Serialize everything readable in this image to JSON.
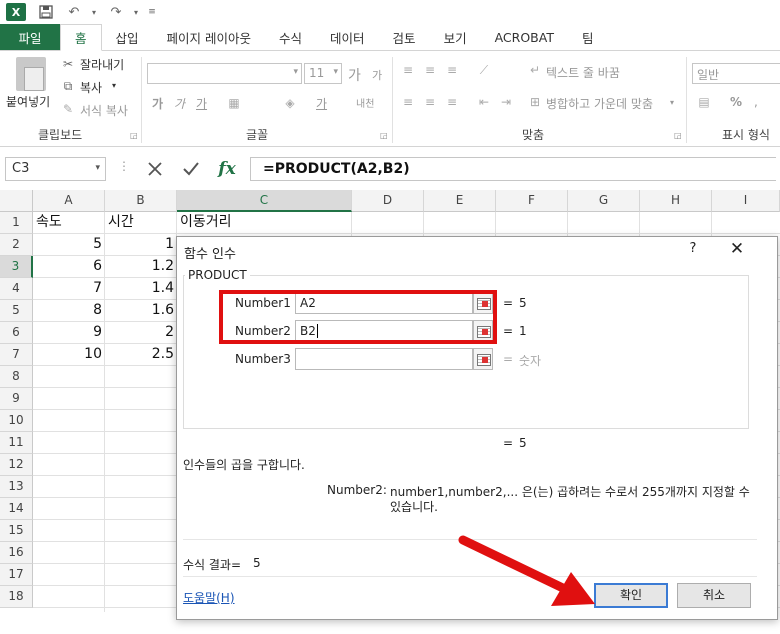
{
  "quick_access": {
    "logo": "X",
    "icons": [
      "save-icon",
      "undo-icon",
      "redo-icon",
      "customize-icon"
    ]
  },
  "tabs": [
    "파일",
    "홈",
    "삽입",
    "페이지 레이아웃",
    "수식",
    "데이터",
    "검토",
    "보기",
    "ACROBAT",
    "팀"
  ],
  "ribbon": {
    "clipboard": {
      "paste": "붙여넣기",
      "cut": "잘라내기",
      "copy": "복사",
      "format_painter": "서식 복사",
      "label": "클립보드"
    },
    "font": {
      "size": "11",
      "grow": "가",
      "shrink": "가",
      "bold": "가",
      "italic": "가",
      "underline": "가",
      "color": "가",
      "phonetic": "내천",
      "label": "글꼴"
    },
    "alignment": {
      "wrap": "텍스트 줄 바꿈",
      "merge": "병합하고 가운데 맞춤",
      "label": "맞춤"
    },
    "number": {
      "format": "일반",
      "percent": "%",
      "label": "표시 형식"
    }
  },
  "formula_bar": {
    "name_box": "C3",
    "fx": "fx",
    "formula": "=PRODUCT(A2,B2)"
  },
  "grid": {
    "columns": [
      "A",
      "B",
      "C",
      "D",
      "E",
      "F",
      "G",
      "H",
      "I"
    ],
    "rows": [
      "1",
      "2",
      "3",
      "4",
      "5",
      "6",
      "7",
      "8",
      "9",
      "10",
      "11",
      "12",
      "13",
      "14",
      "15",
      "16",
      "17",
      "18"
    ],
    "cells": {
      "A1": "속도",
      "B1": "시간",
      "C1": "이동거리",
      "A2": "5",
      "B2": "1",
      "A3": "6",
      "B3": "1.2",
      "A4": "7",
      "B4": "1.4",
      "A5": "8",
      "B5": "1.6",
      "A6": "9",
      "B6": "2",
      "A7": "10",
      "B7": "2.5"
    },
    "selected_cell": "C3"
  },
  "dialog": {
    "title": "함수 인수",
    "help": "?",
    "close": "✕",
    "function_name": "PRODUCT",
    "args": [
      {
        "label": "Number1",
        "value": "A2",
        "eq": "=",
        "result": "5"
      },
      {
        "label": "Number2",
        "value": "B2",
        "eq": "=",
        "result": "1"
      },
      {
        "label": "Number3",
        "value": "",
        "eq": "=",
        "result": "숫자"
      }
    ],
    "total_eq": "=",
    "total_result": "5",
    "description": "인수들의 곱을 구합니다.",
    "arg_help_label": "Number2:",
    "arg_help_text_1": "number1,number2,... 은(는) 곱하려는 수로서 255개까지 지정할 수",
    "arg_help_text_2": "있습니다.",
    "formula_result_label": "수식 결과=",
    "formula_result_value": "5",
    "help_link": "도움말(H)",
    "ok": "확인",
    "cancel": "취소"
  },
  "colors": {
    "excel_green": "#217346",
    "highlight_red": "#e01010",
    "link_blue": "#1a55b5"
  }
}
